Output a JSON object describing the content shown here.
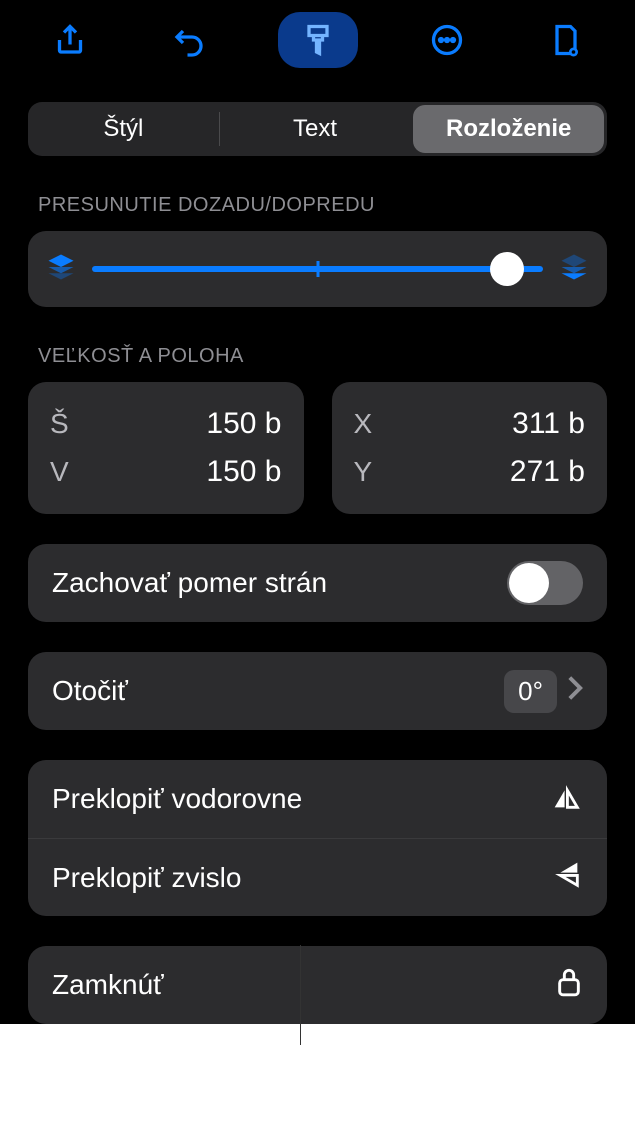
{
  "tabs": {
    "style": "Štýl",
    "text": "Text",
    "layout": "Rozloženie",
    "active": "layout"
  },
  "arrange": {
    "title": "PRESUNUTIE DOZADU/DOPREDU",
    "value_pct": 92
  },
  "sizepos": {
    "title": "VEĽKOSŤ A POLOHA",
    "w_label": "Š",
    "w_value": "150 b",
    "h_label": "V",
    "h_value": "150 b",
    "x_label": "X",
    "x_value": "311 b",
    "y_label": "Y",
    "y_value": "271 b"
  },
  "aspect": {
    "label": "Zachovať pomer strán",
    "on": false
  },
  "rotate": {
    "label": "Otočiť",
    "value": "0°"
  },
  "flip": {
    "h": "Preklopiť vodorovne",
    "v": "Preklopiť zvislo"
  },
  "lock": {
    "label": "Zamknúť"
  }
}
